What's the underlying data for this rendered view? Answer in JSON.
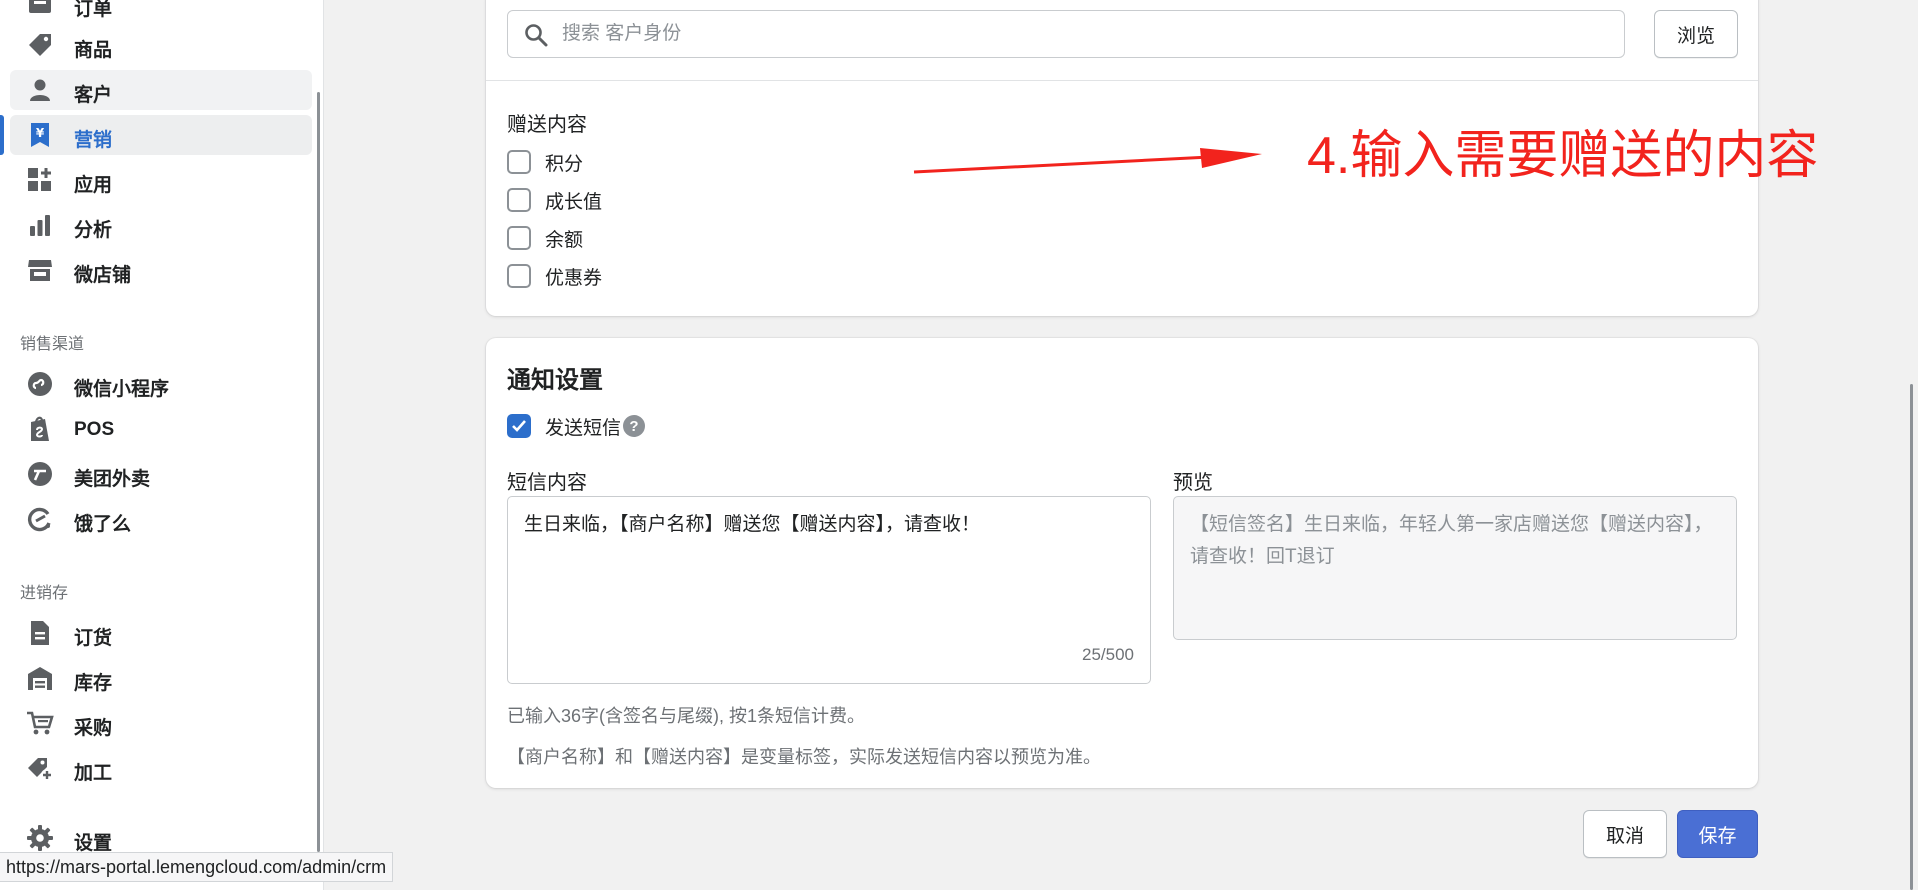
{
  "sidebar": {
    "items": [
      {
        "label": "订单",
        "icon": "orders-icon"
      },
      {
        "label": "商品",
        "icon": "tag-icon"
      },
      {
        "label": "客户",
        "icon": "person-icon"
      },
      {
        "label": "营销",
        "icon": "marketing-icon"
      },
      {
        "label": "应用",
        "icon": "apps-icon"
      },
      {
        "label": "分析",
        "icon": "bar-chart-icon"
      },
      {
        "label": "微店铺",
        "icon": "store-icon"
      }
    ],
    "sales_section": "销售渠道",
    "sales_items": [
      {
        "label": "微信小程序",
        "icon": "mini-program-icon"
      },
      {
        "label": "POS",
        "icon": "pos-bag-icon"
      },
      {
        "label": "美团外卖",
        "icon": "meituan-icon"
      },
      {
        "label": "饿了么",
        "icon": "eleme-icon"
      }
    ],
    "inventory_section": "进销存",
    "inventory_items": [
      {
        "label": "订货",
        "icon": "document-icon"
      },
      {
        "label": "库存",
        "icon": "warehouse-icon"
      },
      {
        "label": "采购",
        "icon": "cart-icon"
      },
      {
        "label": "加工",
        "icon": "tag-plus-icon"
      }
    ],
    "settings_label": "设置",
    "active_item": "营销",
    "accent_color": "#2c6ecb"
  },
  "status_bar": {
    "url": "https://mars-portal.lemengcloud.com/admin/crm"
  },
  "customer_search": {
    "placeholder": "搜索 客户身份",
    "browse_label": "浏览"
  },
  "gift": {
    "title": "赠送内容",
    "options": [
      {
        "label": "积分",
        "checked": false
      },
      {
        "label": "成长值",
        "checked": false
      },
      {
        "label": "余额",
        "checked": false
      },
      {
        "label": "优惠券",
        "checked": false
      }
    ]
  },
  "annotation": {
    "text": "4.输入需要赠送的内容",
    "color": "#f2231d"
  },
  "notification": {
    "title": "通知设置",
    "send_sms_label": "发送短信",
    "send_sms_checked": true,
    "help_glyph": "?",
    "sms_label": "短信内容",
    "sms_content": "生日来临，【商户名称】赠送您【赠送内容】，请查收！",
    "sms_counter": "25/500",
    "preview_label": "预览",
    "preview_content": "【短信签名】生日来临，年轻人第一家店赠送您【赠送内容】，请查收！回T退订",
    "hint_1": "已输入36字(含签名与尾缀), 按1条短信计费。",
    "hint_2": "【商户名称】和【赠送内容】是变量标签，实际发送短信内容以预览为准。"
  },
  "footer": {
    "cancel_label": "取消",
    "save_label": "保存",
    "primary_color": "#4a6fd4"
  }
}
